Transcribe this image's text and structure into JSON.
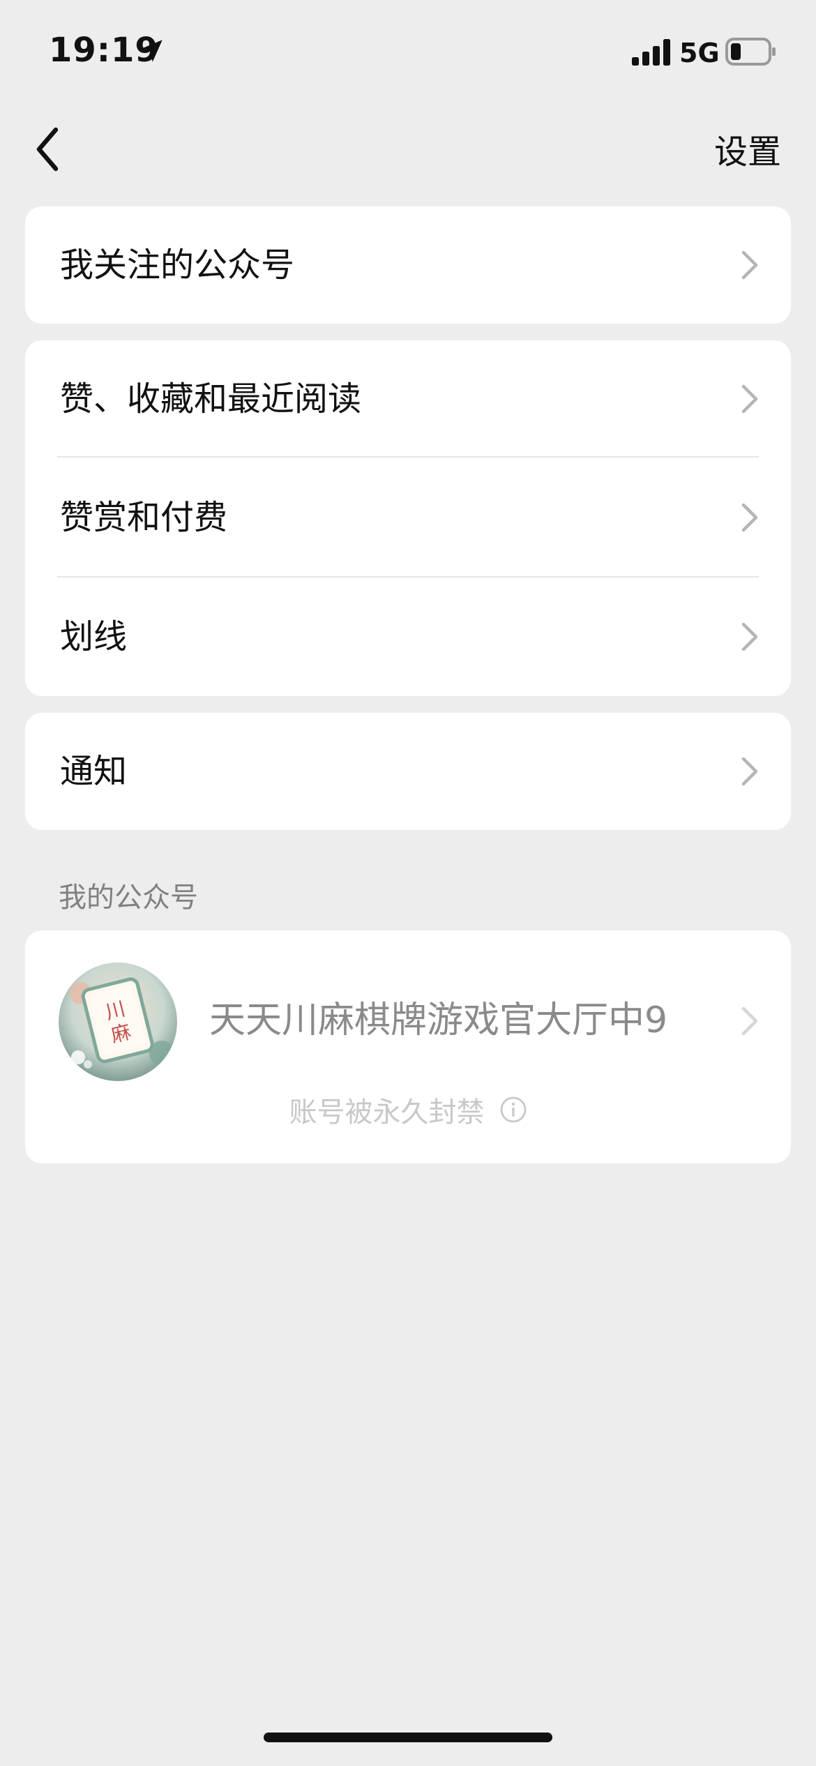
{
  "status_bar": {
    "time": "19:19",
    "network": "5G",
    "location_icon": "location-arrow-icon"
  },
  "nav": {
    "title": "设置",
    "back_icon": "chevron-left-icon"
  },
  "menu_groups": [
    {
      "items": [
        {
          "label": "我关注的公众号"
        }
      ]
    },
    {
      "items": [
        {
          "label": "赞、收藏和最近阅读"
        },
        {
          "label": "赞赏和付费"
        },
        {
          "label": "划线"
        }
      ]
    },
    {
      "items": [
        {
          "label": "通知"
        }
      ]
    }
  ],
  "my_accounts": {
    "section_title": "我的公众号",
    "account": {
      "name": "天天川麻棋牌游戏官大厅中9",
      "status": "账号被永久封禁",
      "avatar_text": "川麻"
    }
  },
  "colors": {
    "background": "#ededed",
    "card": "#ffffff",
    "muted_text": "#8a8a8a",
    "banned_text": "#c8c8c8"
  }
}
